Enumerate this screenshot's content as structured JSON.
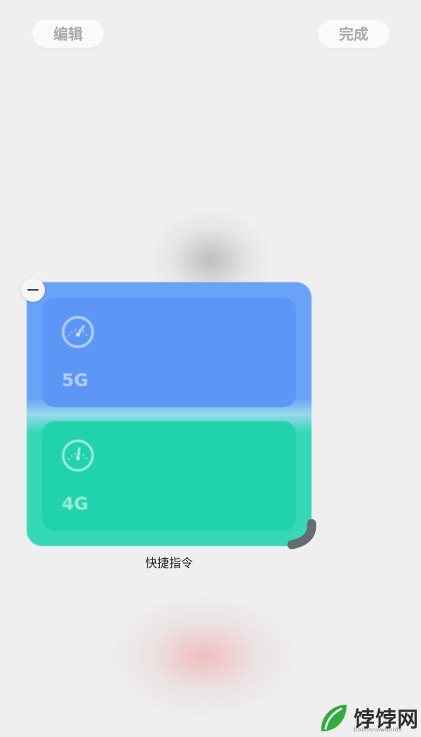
{
  "header": {
    "edit_label": "编辑",
    "done_label": "完成"
  },
  "widget": {
    "tiles": [
      {
        "label": "5G",
        "icon": "speedometer-icon",
        "color": "#5c97f6"
      },
      {
        "label": "4G",
        "icon": "speedometer-icon",
        "color": "#20d3ac"
      }
    ],
    "caption": "快捷指令"
  },
  "watermark": {
    "name": "饽饽网",
    "url": "bobosnowboots"
  },
  "colors": {
    "background": "#efefef",
    "widget_blue": "#69a2f7",
    "widget_green": "#35d9b7"
  }
}
